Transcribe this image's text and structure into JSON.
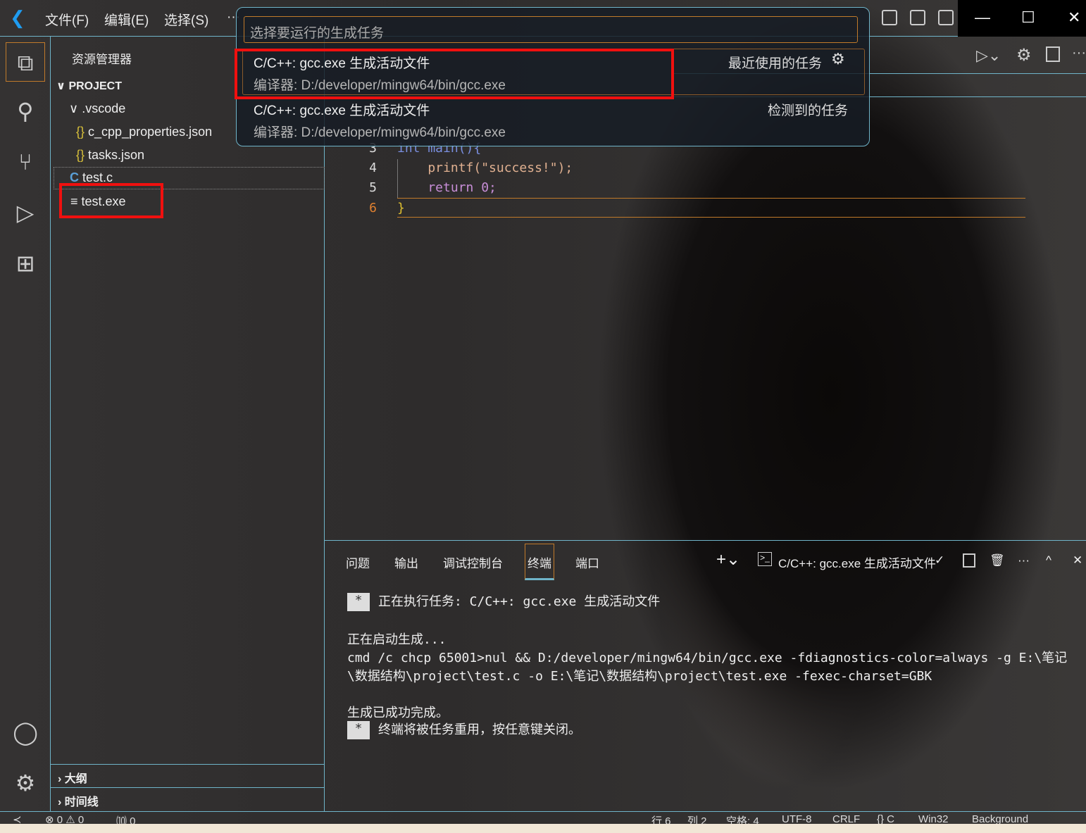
{
  "menu": [
    "文件(F)",
    "编辑(E)",
    "选择(S)",
    "···"
  ],
  "quick_pick": {
    "placeholder": "选择要运行的生成任务",
    "items": [
      {
        "label": "C/C++: gcc.exe 生成活动文件",
        "detail": "编译器: D:/developer/mingw64/bin/gcc.exe",
        "group": "最近使用的任务"
      },
      {
        "label": "C/C++: gcc.exe 生成活动文件",
        "detail": "编译器: D:/developer/mingw64/bin/gcc.exe",
        "group": "检测到的任务"
      }
    ]
  },
  "sidebar": {
    "title": "资源管理器",
    "project": "PROJECT",
    "tree": [
      {
        "label": ".vscode",
        "icon": "chevron-down"
      },
      {
        "label": "c_cpp_properties.json",
        "icon": "{}"
      },
      {
        "label": "tasks.json",
        "icon": "{}"
      },
      {
        "label": "test.c",
        "icon": "C"
      },
      {
        "label": "test.exe",
        "icon": "≡"
      }
    ],
    "outline": "大纲",
    "timeline": "时间线"
  },
  "editor": {
    "lines": [
      {
        "n": "3",
        "text": "int main(){"
      },
      {
        "n": "4",
        "text": "    printf(\"success!\");"
      },
      {
        "n": "5",
        "text": "    return 0;"
      },
      {
        "n": "6",
        "text": "}"
      }
    ]
  },
  "panel": {
    "tabs": [
      "问题",
      "输出",
      "调试控制台",
      "终端",
      "端口"
    ],
    "active_tab": "终端",
    "terminal_name": "C/C++: gcc.exe 生成活动文件",
    "lines": [
      "正在执行任务: C/C++: gcc.exe 生成活动文件",
      "正在启动生成...",
      "cmd /c chcp 65001>nul && D:/developer/mingw64/bin/gcc.exe -fdiagnostics-color=always -g E:\\笔记",
      "\\数据结构\\project\\test.c -o E:\\笔记\\数据结构\\project\\test.exe -fexec-charset=GBK",
      "生成已成功完成。",
      "终端将被任务重用，按任意键关闭。"
    ],
    "star": "*"
  },
  "status": {
    "errors": "⊗ 0 ⚠ 0",
    "ports": "⑽ 0",
    "right": [
      "行 6",
      "列 2",
      "空格: 4",
      "UTF-8",
      "CRLF",
      "{} C",
      "Win32",
      "Background"
    ]
  },
  "colors": {
    "accent": "#6fb4c9",
    "highlight": "#f0100f",
    "focus": "#c07a2a"
  }
}
